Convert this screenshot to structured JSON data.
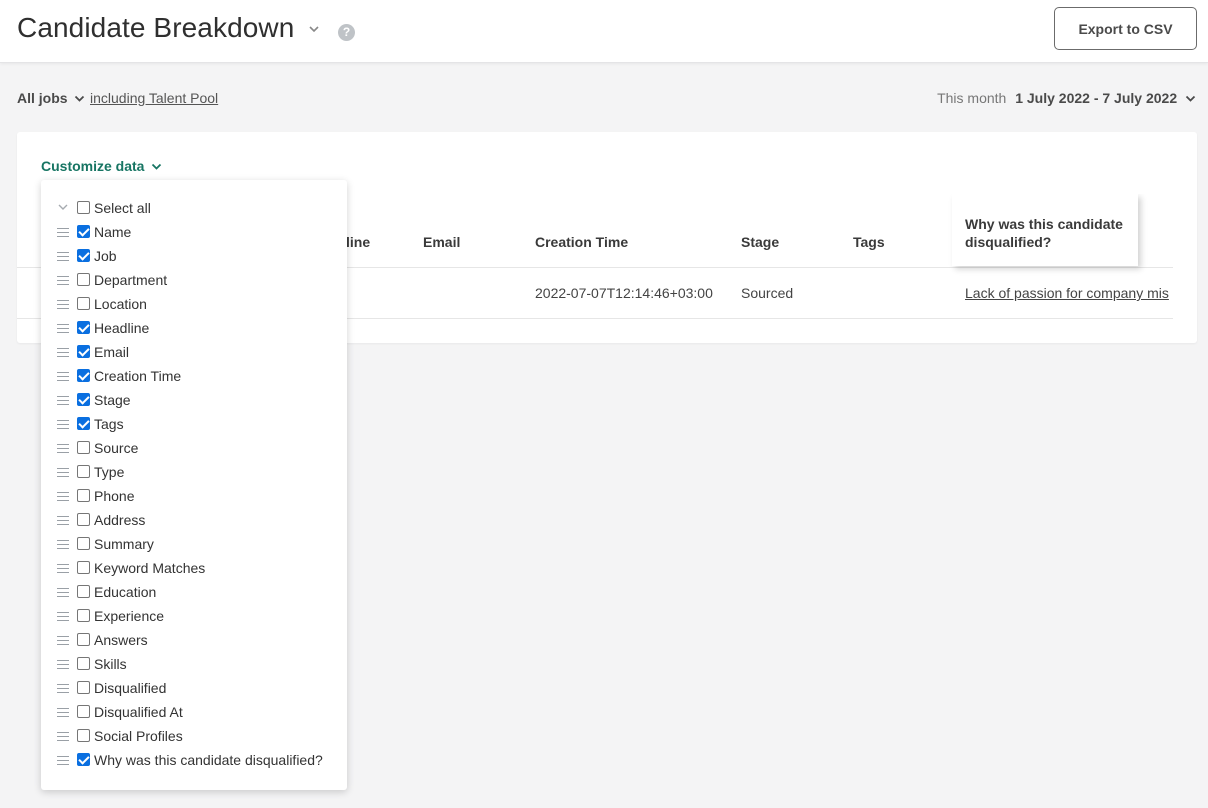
{
  "header": {
    "title": "Candidate Breakdown",
    "help_icon": "question-circle-icon",
    "export_label": "Export to CSV"
  },
  "filters": {
    "jobs_label": "All jobs",
    "talent_pool_link": "including Talent Pool",
    "date_prefix": "This month",
    "date_range": "1 July 2022 - 7 July 2022"
  },
  "customize": {
    "label": "Customize data",
    "select_all_label": "Select all",
    "items": [
      {
        "label": "Name",
        "checked": true
      },
      {
        "label": "Job",
        "checked": true
      },
      {
        "label": "Department",
        "checked": false
      },
      {
        "label": "Location",
        "checked": false
      },
      {
        "label": "Headline",
        "checked": true
      },
      {
        "label": "Email",
        "checked": true
      },
      {
        "label": "Creation Time",
        "checked": true
      },
      {
        "label": "Stage",
        "checked": true
      },
      {
        "label": "Tags",
        "checked": true
      },
      {
        "label": "Source",
        "checked": false
      },
      {
        "label": "Type",
        "checked": false
      },
      {
        "label": "Phone",
        "checked": false
      },
      {
        "label": "Address",
        "checked": false
      },
      {
        "label": "Summary",
        "checked": false
      },
      {
        "label": "Keyword Matches",
        "checked": false
      },
      {
        "label": "Education",
        "checked": false
      },
      {
        "label": "Experience",
        "checked": false
      },
      {
        "label": "Answers",
        "checked": false
      },
      {
        "label": "Skills",
        "checked": false
      },
      {
        "label": "Disqualified",
        "checked": false
      },
      {
        "label": "Disqualified At",
        "checked": false
      },
      {
        "label": "Social Profiles",
        "checked": false
      },
      {
        "label": "Why was this candidate disqualified?",
        "checked": true
      }
    ]
  },
  "table": {
    "columns": {
      "headline_partial": "line",
      "email": "Email",
      "creation_time": "Creation Time",
      "stage": "Stage",
      "tags": "Tags",
      "disqualified_reason": "Why was this candidate disqualified?"
    },
    "row": {
      "creation_time": "2022-07-07T12:14:46+03:00",
      "stage": "Sourced",
      "disqualified_reason": "Lack of passion for company mis"
    }
  },
  "colors": {
    "accent": "#177563",
    "checkbox": "#0a6fe0"
  }
}
